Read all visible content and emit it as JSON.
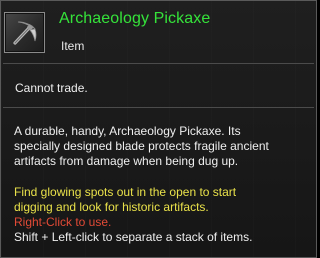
{
  "item": {
    "name": "Archaeology Pickaxe",
    "type": "Item",
    "icon": "pickaxe-icon"
  },
  "restriction": "Cannot trade.",
  "description_lines": [
    "A durable, handy, Archaeology Pickaxe. Its",
    "specially designed blade protects fragile ancient",
    "artifacts from damage when being dug up."
  ],
  "usage_lines": [
    "Find glowing spots out in the open to start",
    "digging and look for historic artifacts."
  ],
  "right_click_hint": "Right-Click to use.",
  "split_hint": "Shift + Left-click to separate a stack of items.",
  "colors": {
    "name": "#35e33a",
    "usage": "#e9e14a",
    "right_click": "#e24a36",
    "text": "#efefef"
  }
}
